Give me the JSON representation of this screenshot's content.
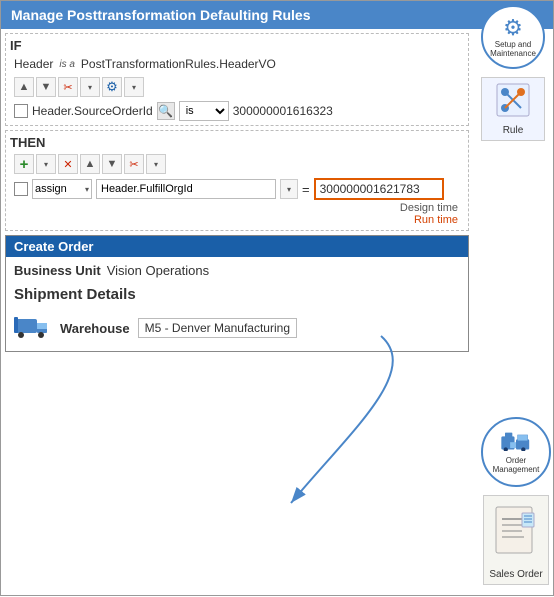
{
  "title": "Manage Posttransformation Defaulting Rules",
  "sidebar": {
    "setup_maintenance_label": "Setup and\nMaintenance",
    "setup_icon": "⚙",
    "rule_label": "Rule",
    "rule_icon": "🔀",
    "order_management_label": "Order\nManagement",
    "order_mgmt_icon": "🏭",
    "sales_order_label": "Sales\nOrder",
    "sales_order_icon": "📋"
  },
  "if_section": {
    "label": "IF",
    "header_label": "Header",
    "is_a_label": "is\na",
    "condition_value": "PostTransformationRules.HeaderVO",
    "toolbar": {
      "up_arrow": "▲",
      "down_arrow": "▼",
      "scissors": "✂",
      "dropdown": "▾",
      "gear": "⚙",
      "dropdown2": "▾"
    },
    "condition_field": "Header.SourceOrderId",
    "condition_operator": "is",
    "condition_operand_value": "300000001616323"
  },
  "then_section": {
    "label": "THEN",
    "toolbar": {
      "plus": "+",
      "dropdown": "▾",
      "cross": "✕",
      "up_arrow": "▲",
      "down_arrow": "▼",
      "scissors": "✂",
      "dropdown2": "▾"
    },
    "assign_label": "assign",
    "field_name": "Header.FulfillOrgId",
    "equals": "=",
    "value": "300000001621783"
  },
  "time_labels": {
    "design_time": "Design time",
    "run_time": "Run time"
  },
  "create_order": {
    "header": "Create Order",
    "business_unit_label": "Business Unit",
    "business_unit_value": "Vision Operations",
    "shipment_details_label": "Shipment Details",
    "warehouse_label": "Warehouse",
    "warehouse_value": "M5 - Denver Manufacturing"
  }
}
